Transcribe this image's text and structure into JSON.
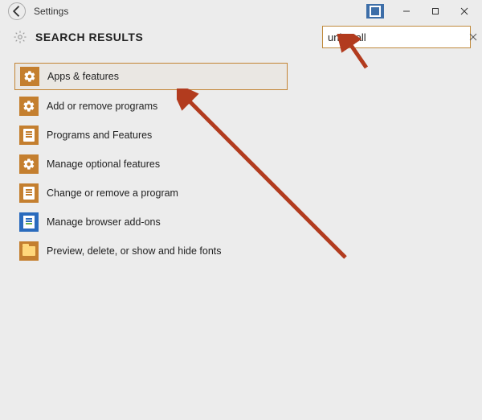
{
  "titlebar": {
    "title": "Settings"
  },
  "header": {
    "title": "SEARCH RESULTS"
  },
  "search": {
    "value": "uninstall"
  },
  "results": [
    {
      "label": "Apps & features",
      "icon": "gear",
      "selected": true
    },
    {
      "label": "Add or remove programs",
      "icon": "gear"
    },
    {
      "label": "Programs and Features",
      "icon": "programs"
    },
    {
      "label": "Manage optional features",
      "icon": "gear"
    },
    {
      "label": "Change or remove a program",
      "icon": "programs"
    },
    {
      "label": "Manage browser add-ons",
      "icon": "addons"
    },
    {
      "label": "Preview, delete, or show and hide fonts",
      "icon": "folder"
    }
  ]
}
